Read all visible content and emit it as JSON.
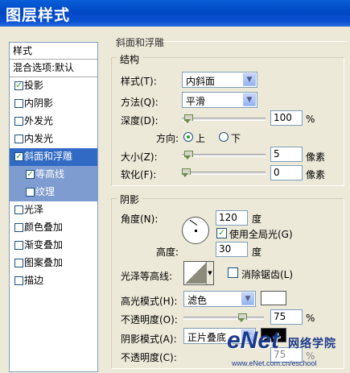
{
  "window": {
    "title": "图层样式"
  },
  "left_panel": {
    "header": "样式",
    "blend": "混合选项:默认",
    "items": [
      {
        "label": "投影",
        "checked": true
      },
      {
        "label": "内阴影",
        "checked": false
      },
      {
        "label": "外发光",
        "checked": false
      },
      {
        "label": "内发光",
        "checked": false
      },
      {
        "label": "斜面和浮雕",
        "checked": true,
        "selected": true
      },
      {
        "label": "等高线",
        "checked": true,
        "sub": true
      },
      {
        "label": "纹理",
        "checked": false,
        "sub": true
      },
      {
        "label": "光泽",
        "checked": false
      },
      {
        "label": "颜色叠加",
        "checked": false
      },
      {
        "label": "渐变叠加",
        "checked": false
      },
      {
        "label": "图案叠加",
        "checked": false
      },
      {
        "label": "描边",
        "checked": false
      }
    ]
  },
  "section_title": "斜面和浮雕",
  "structure": {
    "title": "结构",
    "style_label": "样式(T):",
    "style_value": "内斜面",
    "method_label": "方法(Q):",
    "method_value": "平滑",
    "depth_label": "深度(D):",
    "depth_value": "100",
    "depth_unit": "%",
    "depth_pos": 0.03,
    "direction_label": "方向:",
    "dir_up": "上",
    "dir_down": "下",
    "size_label": "大小(Z):",
    "size_value": "5",
    "size_unit": "像素",
    "size_pos": 0.03,
    "soften_label": "软化(F):",
    "soften_value": "0",
    "soften_unit": "像素",
    "soften_pos": 0.0
  },
  "shading": {
    "title": "阴影",
    "angle_label": "角度(N):",
    "angle_value": "120",
    "angle_unit": "度",
    "global_light": "使用全局光(G)",
    "altitude_label": "高度:",
    "altitude_value": "30",
    "altitude_unit": "度",
    "gloss_label": "光泽等高线:",
    "antialias": "消除锯齿(L)",
    "highlight_mode_label": "高光模式(H):",
    "highlight_mode": "滤色",
    "highlight_color": "#ffffff",
    "opacity_label": "不透明度(O):",
    "opacity_value": "75",
    "opacity_unit": "%",
    "opacity_pos": 0.75,
    "shadow_mode_label": "阴影模式(A):",
    "shadow_mode": "正片叠底",
    "shadow_color": "#000000",
    "opacity2_label": "不透明度(C):",
    "opacity2_value": "75",
    "opacity2_unit": "%"
  },
  "watermark": {
    "logo": "eNet",
    "cn": "网络学院",
    "url": "www.eNet.com.cn/eschool"
  }
}
